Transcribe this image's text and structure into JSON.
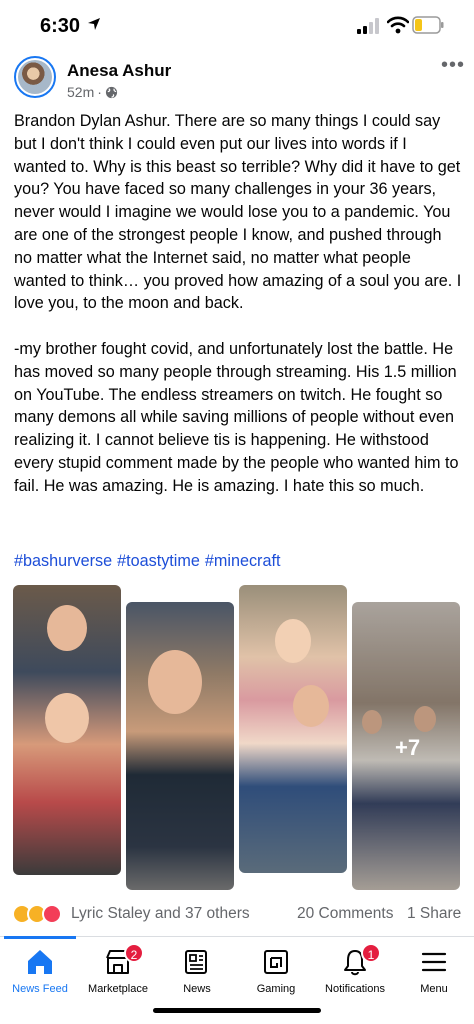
{
  "status_bar": {
    "time": "6:30"
  },
  "post": {
    "author": "Anesa Ashur",
    "time_ago": "52m",
    "separator": "·",
    "more_label": "•••",
    "paragraphs": [
      "Brandon Dylan Ashur. There are so many things I could say but I don't think I could even put our lives into words if I wanted to. Why is this beast so terrible? Why did it have to get you? You have faced so many challenges in your 36 years, never would I imagine we would lose you to a pandemic. You are one of the strongest people I know, and pushed through no matter what the Internet said, no matter what people wanted to think… you proved how amazing of a soul you are. I love you, to the moon and back.",
      "-my brother fought covid, and unfortunately lost the battle. He has moved so many people through streaming. His 1.5 million on YouTube. The endless streamers on twitch. He fought so many demons all while saving millions of people without even realizing it. I cannot believe tis is happening. He withstood every stupid comment made by the people who wanted him to fail. He was amazing. He is amazing. I hate this so much."
    ],
    "hashtags": [
      "#bashurverse",
      "#toastytime",
      "#minecraft"
    ],
    "more_photos": "+7",
    "reactors": "Lyric Staley and 37 others",
    "comments": "20 Comments",
    "shares": "1 Share"
  },
  "tabs": [
    {
      "label": "News Feed",
      "icon": "home-icon",
      "active": true
    },
    {
      "label": "Marketplace",
      "icon": "marketplace-icon",
      "badge": "2"
    },
    {
      "label": "News",
      "icon": "news-icon"
    },
    {
      "label": "Gaming",
      "icon": "gaming-icon"
    },
    {
      "label": "Notifications",
      "icon": "bell-icon",
      "badge": "1"
    },
    {
      "label": "Menu",
      "icon": "menu-icon"
    }
  ],
  "colors": {
    "accent": "#1877f2",
    "badge": "#e41e3f",
    "hashtag": "#1d4ed8",
    "meta": "#65676b"
  }
}
